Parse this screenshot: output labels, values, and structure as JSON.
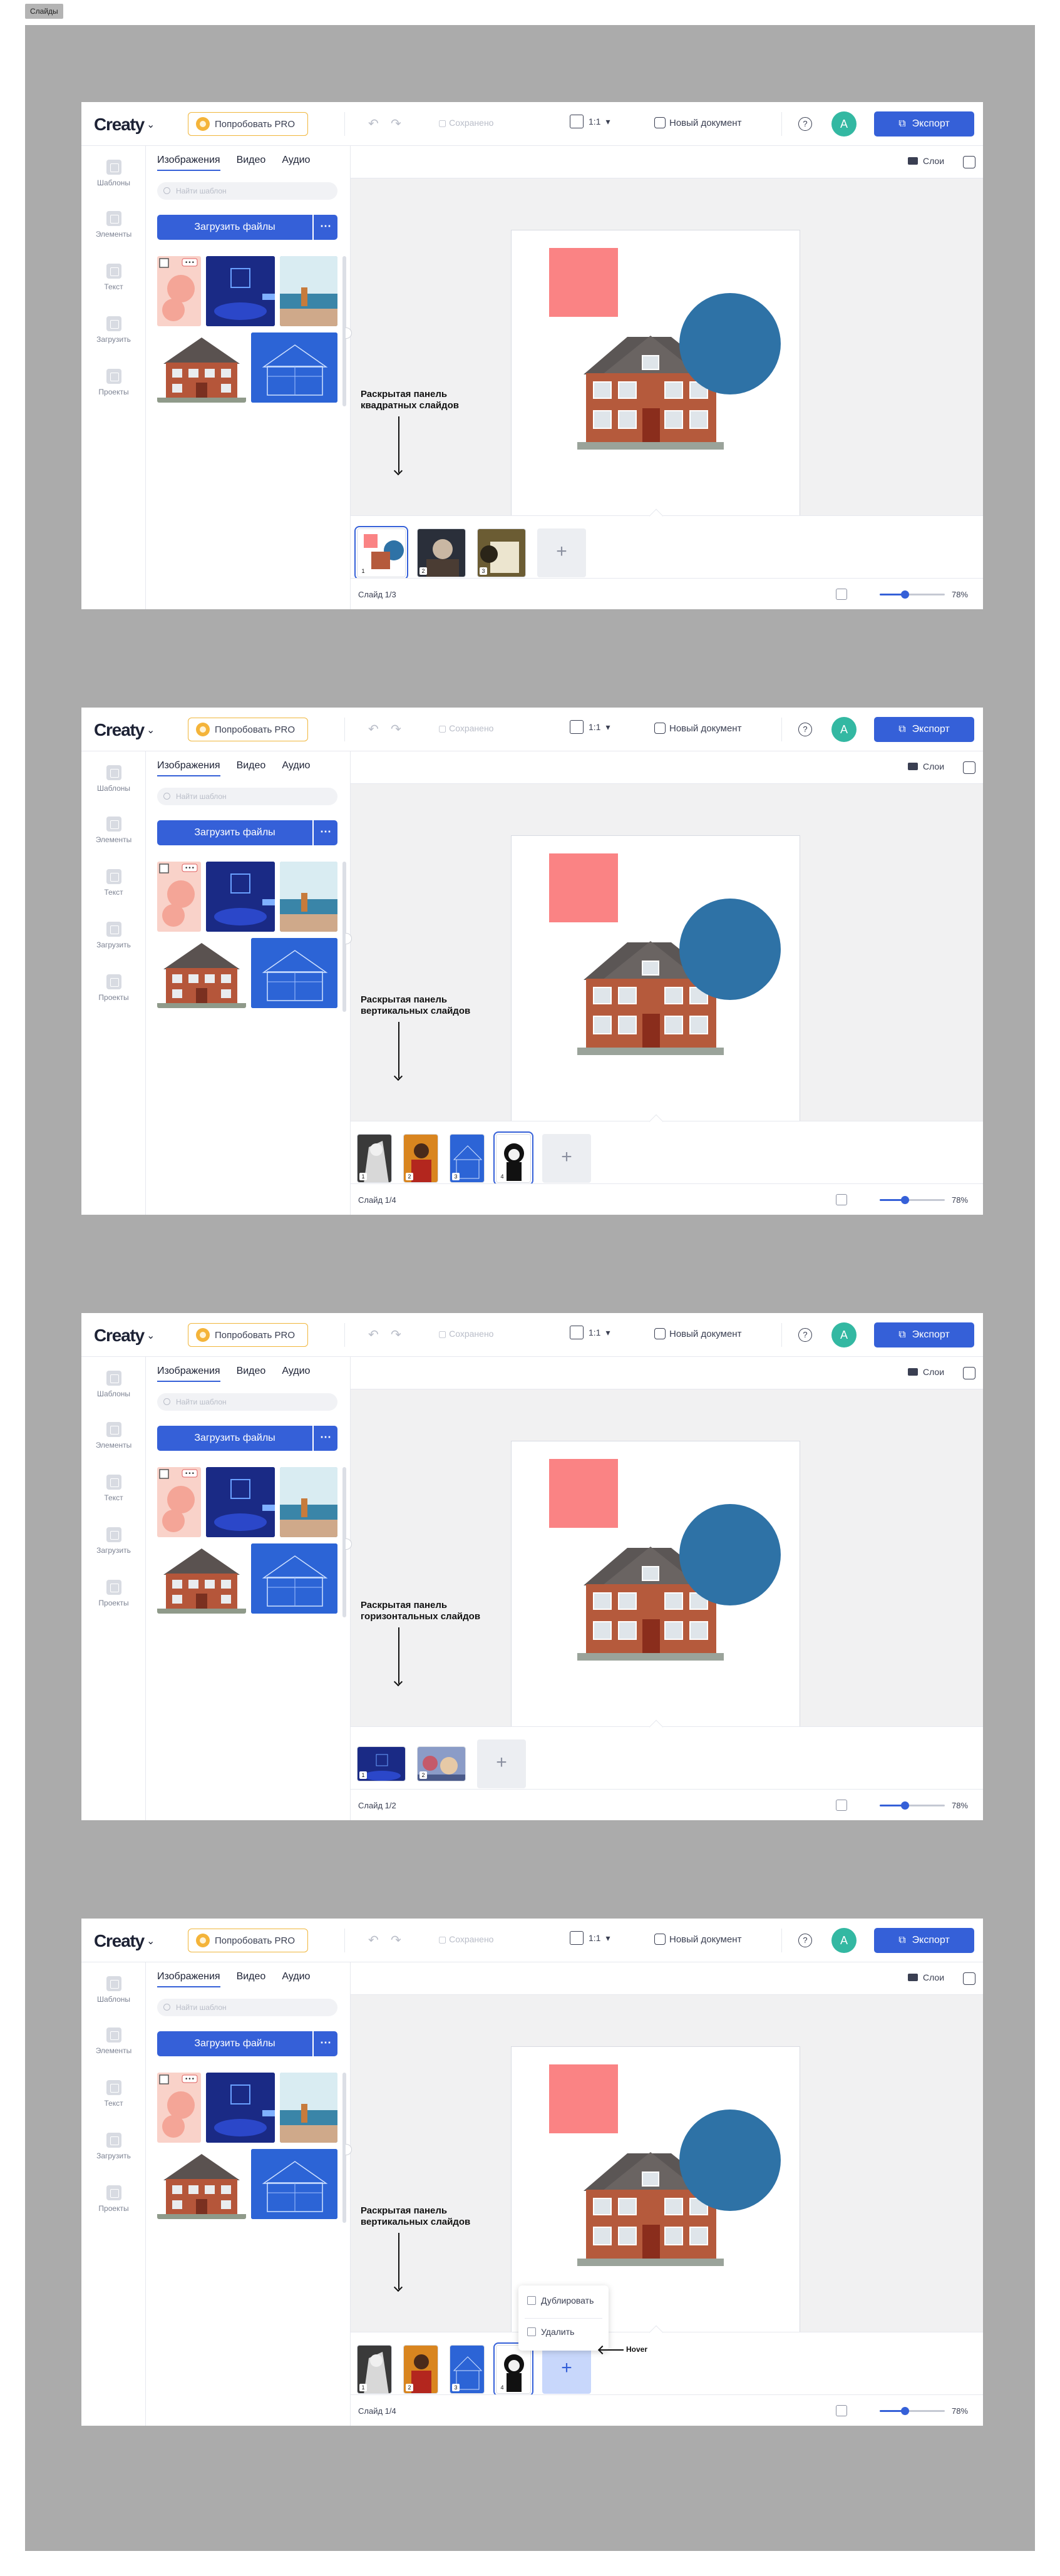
{
  "frame_label": "Слайды",
  "app": {
    "logo": "Creaty",
    "pro_button": "Попробовать PRO",
    "save_status": "Сохранено",
    "ratio": "1:1",
    "new_document": "Новый документ",
    "help": "?",
    "avatar_letter": "A",
    "export": "Экспорт"
  },
  "rail": [
    "Шаблоны",
    "Элементы",
    "Текст",
    "Загрузить",
    "Проекты"
  ],
  "assets": {
    "tabs": [
      "Изображения",
      "Видео",
      "Аудио"
    ],
    "search_placeholder": "Найти шаблон",
    "upload_button": "Загрузить файлы",
    "more": "•••"
  },
  "stage": {
    "layers": "Слои",
    "zoom": "78%"
  },
  "screens": [
    {
      "note": "Раскрытая панель квадратных слайдов",
      "slide_count": "Слайд 1/3",
      "slides": [
        "1",
        "2",
        "3"
      ]
    },
    {
      "note": "Раскрытая панель вертикальных слайдов",
      "slide_count": "Слайд 1/4",
      "slides": [
        "1",
        "2",
        "3",
        "4"
      ]
    },
    {
      "note": "Раскрытая панель горизонтальных слайдов",
      "slide_count": "Слайд 1/2",
      "slides": [
        "1",
        "2"
      ]
    },
    {
      "note": "Раскрытая панель вертикальных слайдов",
      "slide_count": "Слайд 1/4",
      "slides": [
        "1",
        "2",
        "3",
        "4"
      ],
      "context_menu": [
        "Дублировать",
        "Удалить"
      ],
      "hover_label": "Hover"
    }
  ],
  "colors": {
    "accent": "#3560d8",
    "pro_border": "#f0b63a",
    "avatar": "#33b8a2",
    "pink_square": "#fa8384",
    "blue_circle": "#2e72a6"
  }
}
